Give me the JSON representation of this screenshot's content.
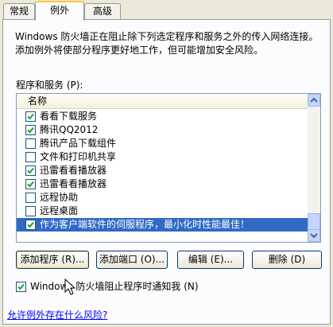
{
  "tabs": [
    {
      "label": "常规",
      "active": false
    },
    {
      "label": "例外",
      "active": true
    },
    {
      "label": "高级",
      "active": false
    }
  ],
  "description": "Windows 防火墙正在阻止除下列选定程序和服务之外的传入网络连接。添加例外将使部分程序更好地工作，但可能增加安全风险。",
  "list_label": "程序和服务 (P):",
  "list": {
    "column_header": "名称",
    "items": [
      {
        "label": "看看下载服务",
        "checked": true,
        "selected": false
      },
      {
        "label": "腾讯QQ2012",
        "checked": true,
        "selected": false
      },
      {
        "label": "腾讯产品下载组件",
        "checked": false,
        "selected": false
      },
      {
        "label": "文件和打印机共享",
        "checked": false,
        "selected": false
      },
      {
        "label": "迅雷看看播放器",
        "checked": true,
        "selected": false
      },
      {
        "label": "迅雷看看播放器",
        "checked": true,
        "selected": false
      },
      {
        "label": "远程协助",
        "checked": false,
        "selected": false
      },
      {
        "label": "远程桌面",
        "checked": false,
        "selected": false
      },
      {
        "label": "作为客户端软件的伺服程序，最小化时性能最佳！",
        "checked": true,
        "selected": true
      }
    ]
  },
  "buttons": {
    "add_program": "添加程序 (R)...",
    "add_port": "添加端口 (O)...",
    "edit": "编辑 (E)...",
    "delete": "删除 (D)"
  },
  "notify": {
    "label": "Windows 防火墙阻止程序时通知我 (N)",
    "checked": true
  },
  "link": "允许例外存在什么风险?",
  "colors": {
    "selection": "#316ac5",
    "link": "#0000ff",
    "tab_highlight": "#ffc83c"
  }
}
